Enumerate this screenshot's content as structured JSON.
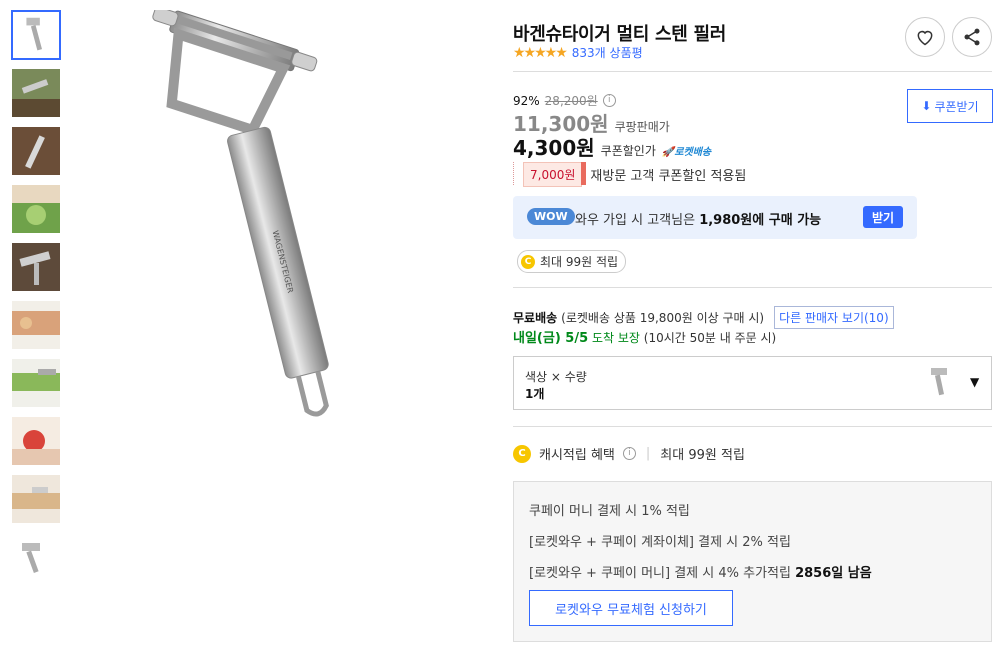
{
  "product": {
    "title": "바겐슈타이거 멀티 스텐 필러",
    "rating_stars": "★★★★★",
    "review_count": "833개 상품평"
  },
  "pricing": {
    "discount_rate": "92%",
    "original_price": "28,200원",
    "coupang_price": "11,300원",
    "coupang_price_label": "쿠팡판매가",
    "coupon_price": "4,300원",
    "coupon_price_label": "쿠폰할인가",
    "rocket_label": "로켓배송",
    "coupon_download": "쿠폰받기",
    "revisit_coupon_amount": "7,000원",
    "revisit_coupon_text": "재방문 고객 쿠폰할인 적용됨"
  },
  "wow": {
    "badge": "WOW",
    "text_prefix": "와우 가입 시 고객님은",
    "text_amount": "1,980원에 구매 가능",
    "join_button": "받기"
  },
  "cashback_pill": {
    "coin": "C",
    "text": "최대 99원 적립"
  },
  "shipping": {
    "free_label": "무료배송",
    "condition": "(로켓배송 상품 19,800원 이상 구매 시)",
    "other_sellers": "다른 판매자 보기(10)",
    "arrival": "내일(금) 5/5",
    "arrival_suffix": "도착 보장",
    "deadline": "(10시간 50분 내 주문 시)"
  },
  "option": {
    "label": "색상 × 수량",
    "value": "1개"
  },
  "cash_benefit": {
    "coin": "C",
    "label": "캐시적립 혜택",
    "amount": "최대 99원 적립"
  },
  "benefits": {
    "line1": "쿠페이 머니 결제 시 1% 적립",
    "line2": "[로켓와우 + 쿠페이 계좌이체] 결제 시 2% 적립",
    "line3_prefix": "[로켓와우 + 쿠페이 머니] 결제 시 4% 추가적립",
    "line3_bold": "2856일 남음",
    "trial_button": "로켓와우 무료체험 신청하기"
  },
  "colors": {
    "accent": "#346aff",
    "star": "#f5a623",
    "arrival_green": "#00891a",
    "coupon_red": "#c8102e"
  }
}
